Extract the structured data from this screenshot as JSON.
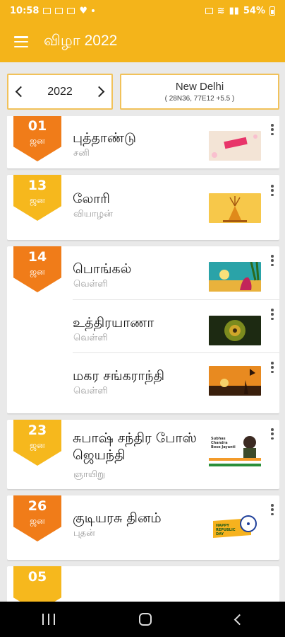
{
  "status_bar": {
    "time": "10:58",
    "battery": "54%"
  },
  "app_bar": {
    "title": "விழா 2022"
  },
  "year_selector": {
    "year": "2022"
  },
  "location": {
    "city": "New Delhi",
    "coords": "( 28N36, 77E12 +5.5 )"
  },
  "cards": [
    {
      "day": "01",
      "month": "ஜன",
      "color": "orange",
      "festivals": [
        {
          "name": "புத்தாண்டு",
          "weekday": "சனி",
          "thumb": "new-year-thumb"
        }
      ]
    },
    {
      "day": "13",
      "month": "ஜன",
      "color": "yellow",
      "festivals": [
        {
          "name": "லோரி",
          "weekday": "வியாழன்",
          "thumb": "lohri-thumb"
        }
      ]
    },
    {
      "day": "14",
      "month": "ஜன",
      "color": "orange",
      "festivals": [
        {
          "name": "பொங்கல்",
          "weekday": "வெள்ளி",
          "thumb": "pongal-thumb"
        },
        {
          "name": "உத்திரயாணா",
          "weekday": "வெள்ளி",
          "thumb": "uttarayana-thumb"
        },
        {
          "name": "மகர சங்கராந்தி",
          "weekday": "வெள்ளி",
          "thumb": "makar-sankranti-thumb"
        }
      ]
    },
    {
      "day": "23",
      "month": "ஜன",
      "color": "yellow",
      "festivals": [
        {
          "name": "சுபாஷ் சந்திர போஸ் ஜெயந்தி",
          "weekday": "ஞாயிறு",
          "thumb": "bose-jayanti-thumb",
          "thumb_text": "Subhas Chandra Bose Jayanti"
        }
      ]
    },
    {
      "day": "26",
      "month": "ஜன",
      "color": "orange",
      "festivals": [
        {
          "name": "குடியரசு தினம்",
          "weekday": "புதன்",
          "thumb": "republic-day-thumb",
          "thumb_text": "HAPPY REPUBLIC DAY"
        }
      ]
    },
    {
      "day": "05",
      "month": "",
      "color": "yellow",
      "festivals": []
    }
  ],
  "colors": {
    "primary": "#f4b41a",
    "badge_orange": "#f07c19",
    "badge_yellow": "#f6b81d"
  }
}
